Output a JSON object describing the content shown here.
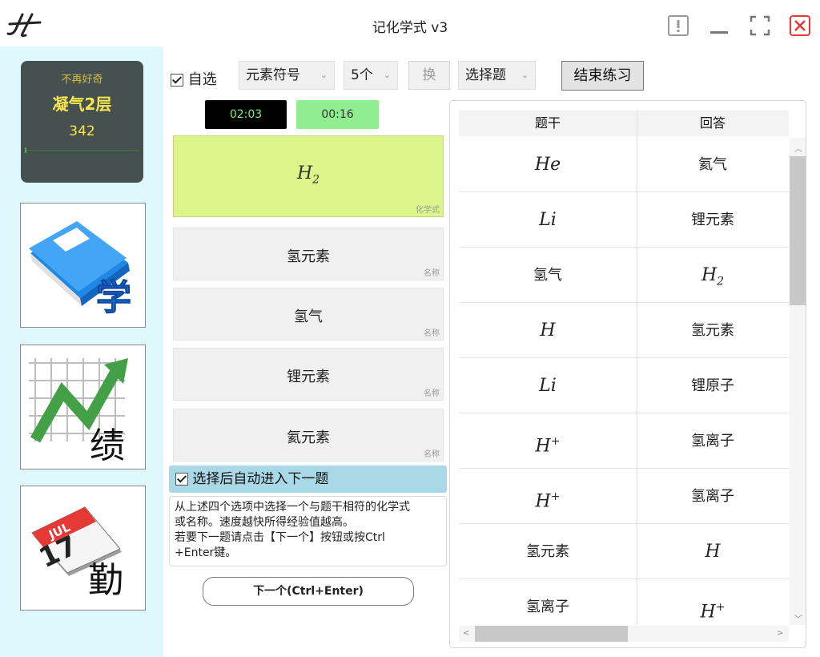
{
  "window": {
    "title": "记化学式 v3"
  },
  "level": {
    "subtitle": "不再好奇",
    "name": "凝气2层",
    "score": "342",
    "progress": 0.01
  },
  "sidebar": {
    "tiles": [
      {
        "label": "学",
        "icon": "book-icon"
      },
      {
        "label": "绩",
        "icon": "chart-icon"
      },
      {
        "label": "勤",
        "icon": "calendar-icon",
        "calendar_month": "JUL",
        "calendar_day": "17"
      }
    ]
  },
  "toolbar": {
    "self_select_label": "自选",
    "mode_value": "元素符号",
    "count_value": "5个",
    "swap_label": "换",
    "type_value": "选择题",
    "end_label": "结束练习"
  },
  "timers": {
    "total": "02:03",
    "current": "00:16"
  },
  "question": {
    "formula_base": "H",
    "formula_sub": "2",
    "tag": "化学式"
  },
  "options": [
    {
      "text": "氢元素",
      "tag": "名称"
    },
    {
      "text": "氢气",
      "tag": "名称"
    },
    {
      "text": "锂元素",
      "tag": "名称"
    },
    {
      "text": "氦元素",
      "tag": "名称"
    }
  ],
  "auto_next_label": "选择后自动进入下一题",
  "info": {
    "line1": "从上述四个选项中选择一个与题干相符的化学式",
    "line2": "或名称。速度越快所得经验值越高。",
    "line3": "若要下一题请点击【下一个】按钮或按Ctrl",
    "line4": "+Enter键。"
  },
  "next_button_label": "下一个(Ctrl+Enter)",
  "history": {
    "headers": {
      "stem": "题干",
      "answer": "回答"
    },
    "rows": [
      {
        "stem": "He",
        "answer": "氦气"
      },
      {
        "stem": "Li",
        "answer": "锂元素"
      },
      {
        "stem": "氢气",
        "answer_base": "H",
        "answer_sub": "2"
      },
      {
        "stem": "H",
        "answer": "氢元素"
      },
      {
        "stem": "Li",
        "answer": "锂原子"
      },
      {
        "stem_base": "H",
        "stem_sup": "+",
        "answer": "氢离子"
      },
      {
        "stem_base": "H",
        "stem_sup": "+",
        "answer": "氢离子"
      },
      {
        "stem": "氢元素",
        "answer": "H"
      },
      {
        "stem": "氢离子",
        "answer_base": "H",
        "answer_sup": "+"
      }
    ]
  },
  "colors": {
    "timer_total_bg": "#000000",
    "timer_current_bg": "#90ee90",
    "question_bg": "#dcf58a",
    "close_red": "#e53935"
  }
}
